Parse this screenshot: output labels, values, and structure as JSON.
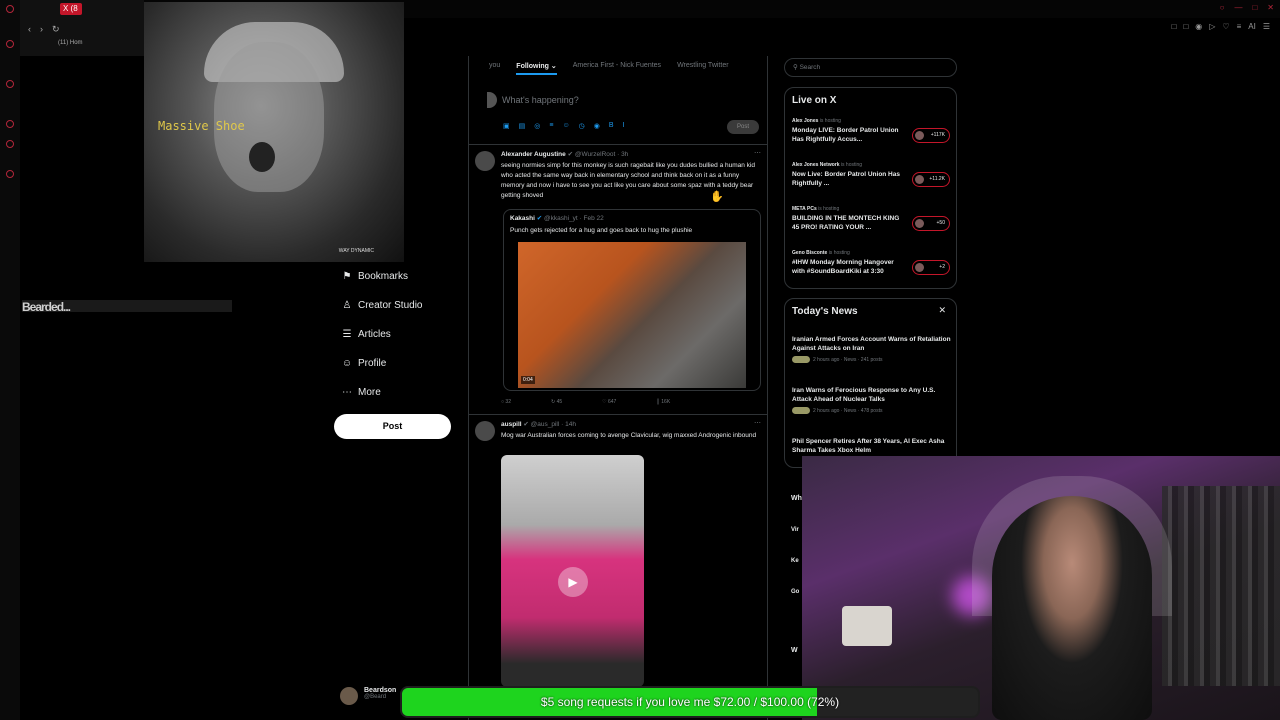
{
  "browser": {
    "tab_badge": "X (8",
    "tab_title": "(11) Hom",
    "nav_icons": [
      "back-icon",
      "forward-icon",
      "reload-icon"
    ],
    "extensions": [
      "□",
      "□",
      "◉",
      "▷",
      "♡",
      "≡",
      "AI",
      "☰"
    ],
    "window_controls": [
      "○",
      "—",
      "□",
      "✕"
    ]
  },
  "overlay": {
    "album_title": "Massive Shoe",
    "album_signature": "WAY DYNAMIC",
    "garbled_text": "Bearded..."
  },
  "left_nav": {
    "items": [
      {
        "icon": "bookmark-icon",
        "glyph": "⚑",
        "label": "Bookmarks"
      },
      {
        "icon": "creator-studio-icon",
        "glyph": "♙",
        "label": "Creator Studio"
      },
      {
        "icon": "articles-icon",
        "glyph": "☰",
        "label": "Articles"
      },
      {
        "icon": "profile-icon",
        "glyph": "☺",
        "label": "Profile"
      },
      {
        "icon": "more-icon",
        "glyph": "⋯",
        "label": "More"
      }
    ],
    "post_label": "Post",
    "account_name": "Beardson",
    "account_handle": "@Beard"
  },
  "main": {
    "tabs": [
      {
        "label": "you",
        "active": false
      },
      {
        "label": "Following ⌄",
        "active": true
      },
      {
        "label": "America First - Nick Fuentes",
        "active": false
      },
      {
        "label": "Wrestling Twitter",
        "active": false
      }
    ],
    "compose_placeholder": "What's happening?",
    "compose_tools": [
      "▣",
      "▤",
      "◎",
      "≡",
      "☺",
      "◷",
      "◉",
      "B",
      "I"
    ],
    "compose_post": "Post",
    "tweet1": {
      "author": "Alexander Augustine",
      "handle": "@WurzelRoot · 3h",
      "text": "seeing normies simp for this monkey is such ragebait like you dudes bullied a human kid who acted the same way back in elementary school and think back on it as a funny memory and now i have to see you act like you care about some spaz with a teddy bear getting shoved",
      "quote_author": "Kakashi",
      "quote_handle": "@kkashi_yt · Feb 22",
      "quote_text": "Punch gets rejected for a hug and goes back to hug the plushie",
      "video_duration": "0:04",
      "actions": [
        "○ 32",
        "↻ 45",
        "♡ 647",
        "║ 16K"
      ]
    },
    "tweet2": {
      "author": "auspill",
      "handle": "@aus_pill · 14h",
      "text": "Mog war Australian forces coming to avenge Clavicular, wig maxxed Androgenic inbound"
    }
  },
  "right": {
    "search_placeholder": "Search",
    "live": {
      "title": "Live on X",
      "items": [
        {
          "host": "Alex Jones",
          "suffix": "is hosting",
          "title": "Monday LIVE: Border Patrol Union Has Rightfully Accus...",
          "count": "+117K"
        },
        {
          "host": "Alex Jones Network",
          "suffix": "is hosting",
          "title": "Now Live: Border Patrol Union Has Rightfully ...",
          "count": "+11.2K"
        },
        {
          "host": "META PCs",
          "suffix": "is hosting",
          "title": "BUILDING IN THE MONTECH KING 45 PRO! RATING YOUR ...",
          "count": "+50"
        },
        {
          "host": "Geno Bisconte",
          "suffix": "is hosting",
          "title": "#IHW Monday Morning Hangover with #SoundBoardKiki at 3:30",
          "count": "+2"
        }
      ]
    },
    "news": {
      "title": "Today's News",
      "items": [
        {
          "title": "Iranian Armed Forces Account Warns of Retaliation Against Attacks on Iran",
          "meta": "2 hours ago · News · 241 posts"
        },
        {
          "title": "Iran Warns of Ferocious Response to Any U.S. Attack Ahead of Nuclear Talks",
          "meta": "2 hours ago · News · 478 posts"
        },
        {
          "title": "Phil Spencer Retires After 38 Years, AI Exec Asha Sharma Takes Xbox Helm",
          "meta": ""
        }
      ],
      "peek": [
        "Wh",
        "Vir",
        "Ke",
        "Go",
        "W"
      ]
    }
  },
  "donation": {
    "text": "$5 song requests if you love me $72.00 / $100.00 (72%)",
    "progress": 0.72,
    "color": "#1ed41e"
  }
}
